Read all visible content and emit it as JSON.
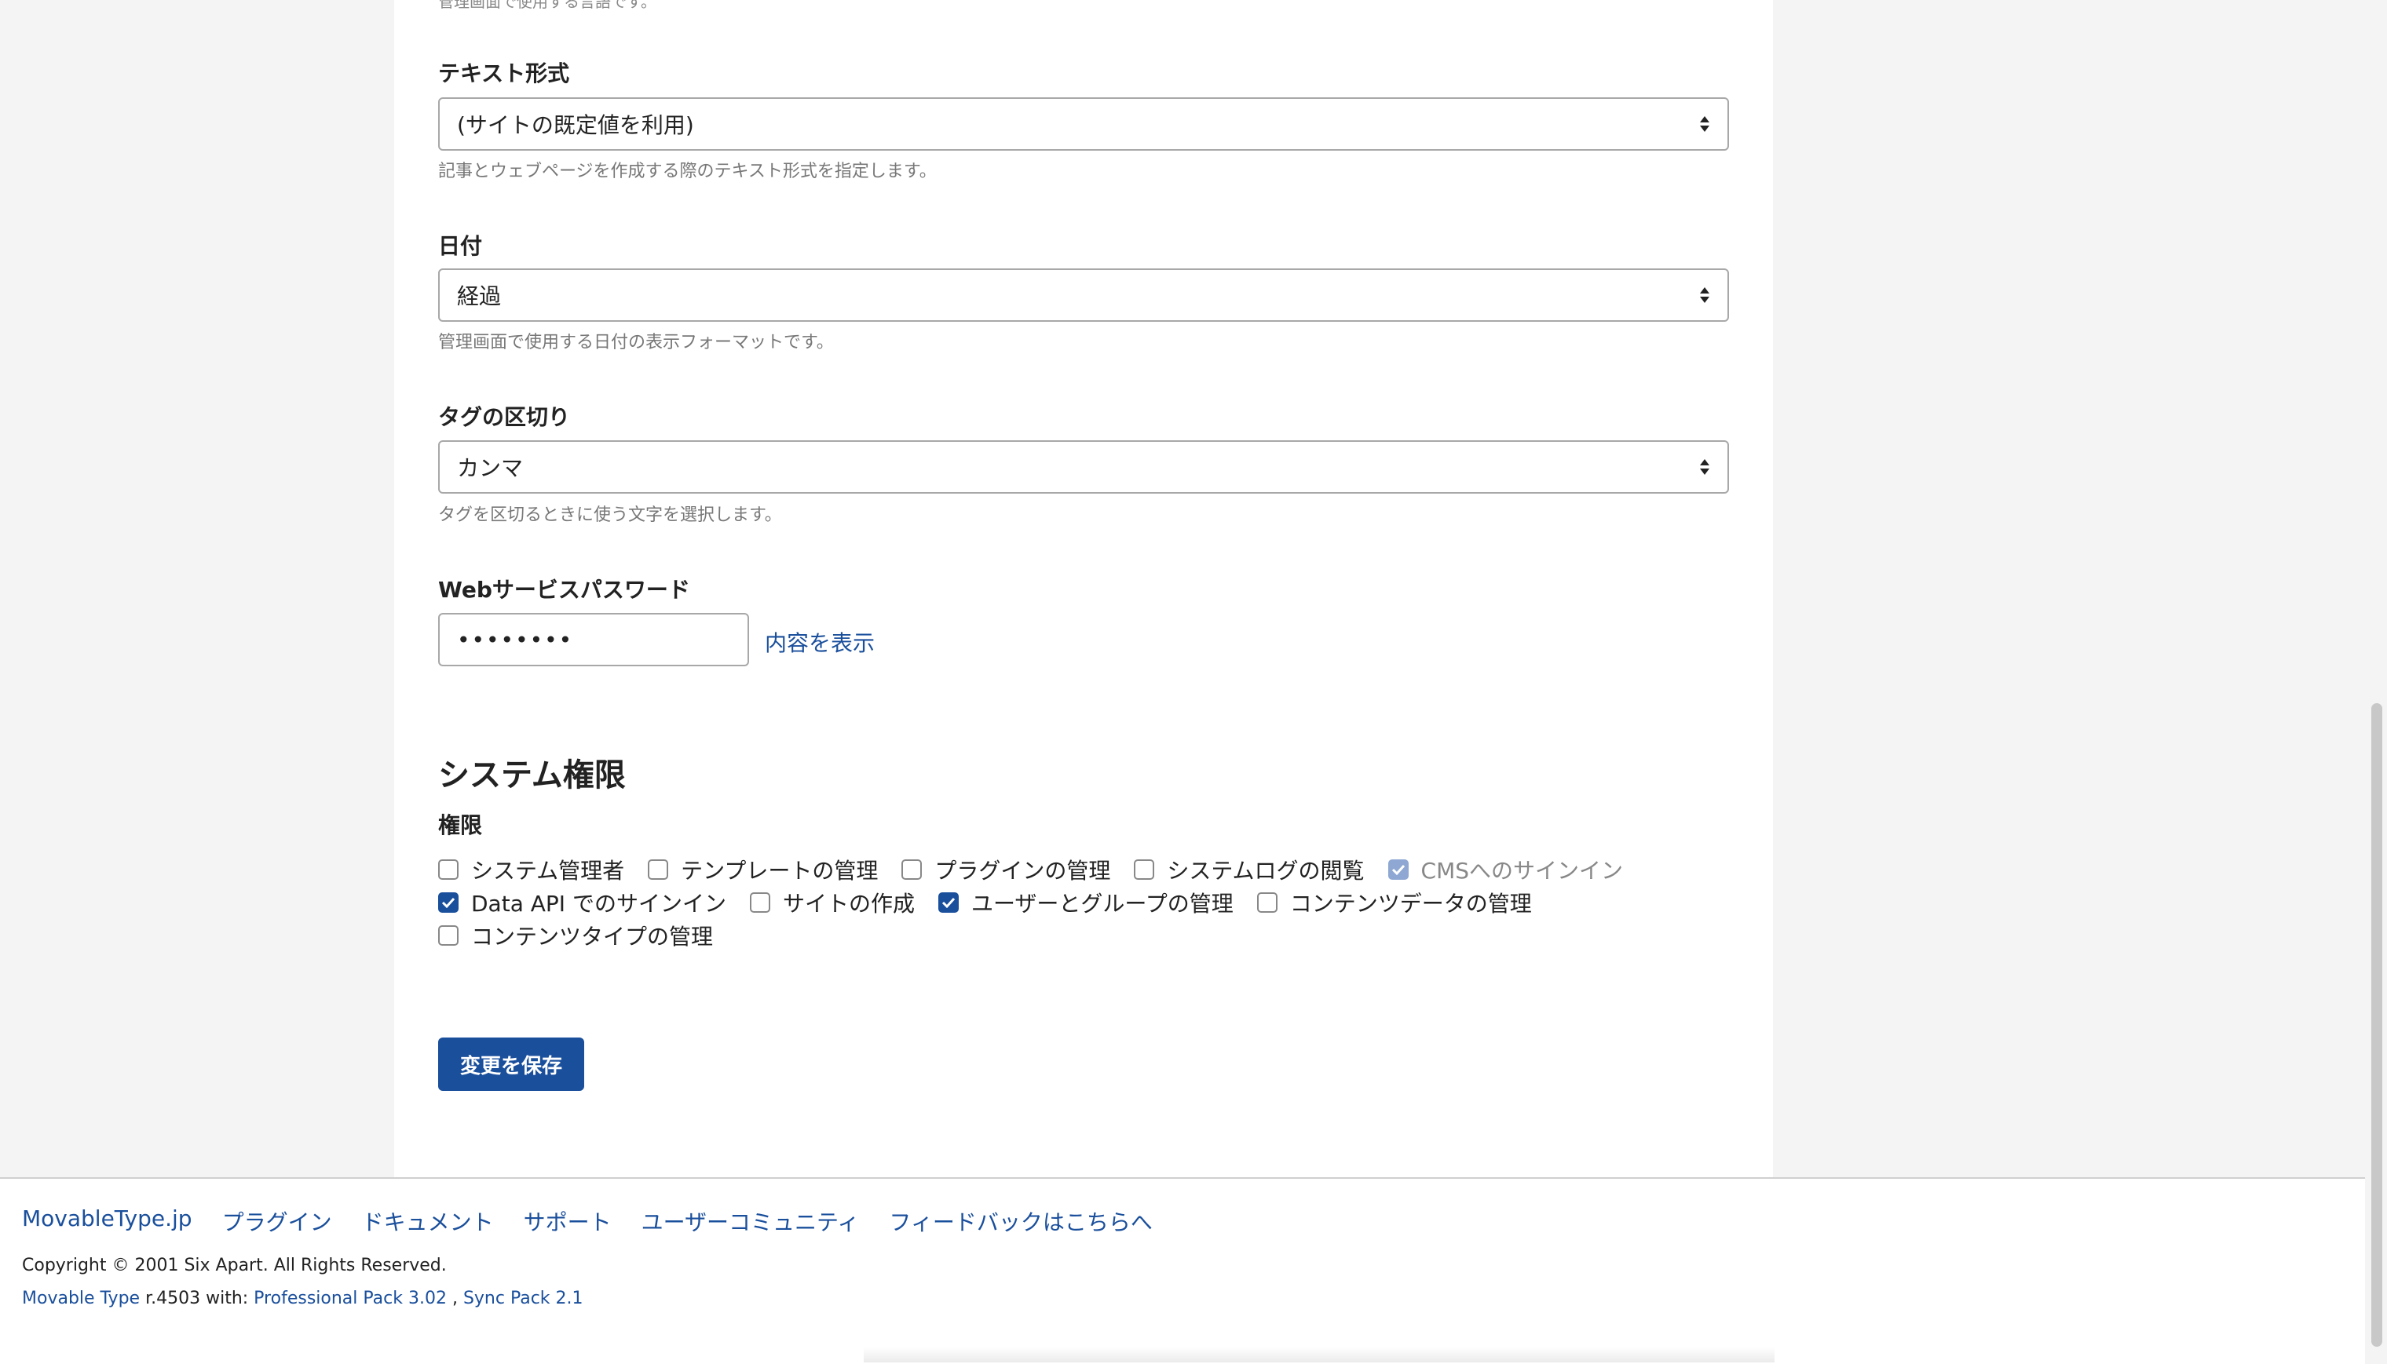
{
  "cut_off_text": "管理画面で使用する言語です。",
  "text_format": {
    "label": "テキスト形式",
    "value": "(サイトの既定値を利用)",
    "hint": "記事とウェブページを作成する際のテキスト形式を指定します。"
  },
  "date": {
    "label": "日付",
    "value": "経過",
    "hint": "管理画面で使用する日付の表示フォーマットです。"
  },
  "tag_delimiter": {
    "label": "タグの区切り",
    "value": "カンマ",
    "hint": "タグを区切るときに使う文字を選択します。"
  },
  "web_service_password": {
    "label": "Webサービスパスワード",
    "value": "••••••••",
    "show_link": "内容を表示"
  },
  "system_permissions": {
    "title": "システム権限",
    "label": "権限",
    "items": [
      {
        "label": "システム管理者",
        "checked": false,
        "disabled": false
      },
      {
        "label": "テンプレートの管理",
        "checked": false,
        "disabled": false
      },
      {
        "label": "プラグインの管理",
        "checked": false,
        "disabled": false
      },
      {
        "label": "システムログの閲覧",
        "checked": false,
        "disabled": false
      },
      {
        "label": "CMSへのサインイン",
        "checked": true,
        "disabled": true
      },
      {
        "label": "Data API でのサインイン",
        "checked": true,
        "disabled": false
      },
      {
        "label": "サイトの作成",
        "checked": false,
        "disabled": false
      },
      {
        "label": "ユーザーとグループの管理",
        "checked": true,
        "disabled": false
      },
      {
        "label": "コンテンツデータの管理",
        "checked": false,
        "disabled": false
      },
      {
        "label": "コンテンツタイプの管理",
        "checked": false,
        "disabled": false
      }
    ]
  },
  "save_button": "変更を保存",
  "footer": {
    "links": [
      "MovableType.jp",
      "プラグイン",
      "ドキュメント",
      "サポート",
      "ユーザーコミュニティ",
      "フィードバックはこちらへ"
    ],
    "copyright": "Copyright © 2001 Six Apart. All Rights Reserved.",
    "product": "Movable Type",
    "version": " r.4503 with: ",
    "pack1": "Professional Pack 3.02",
    "separator": " , ",
    "pack2": "Sync Pack 2.1"
  },
  "colors": {
    "accent": "#1a4f9c",
    "disabled_check": "#8ea8d3",
    "page_background": "#f4f4f4"
  },
  "icons": {
    "select_arrow": "up-down-arrows-icon",
    "checkbox_check": "check-icon"
  }
}
